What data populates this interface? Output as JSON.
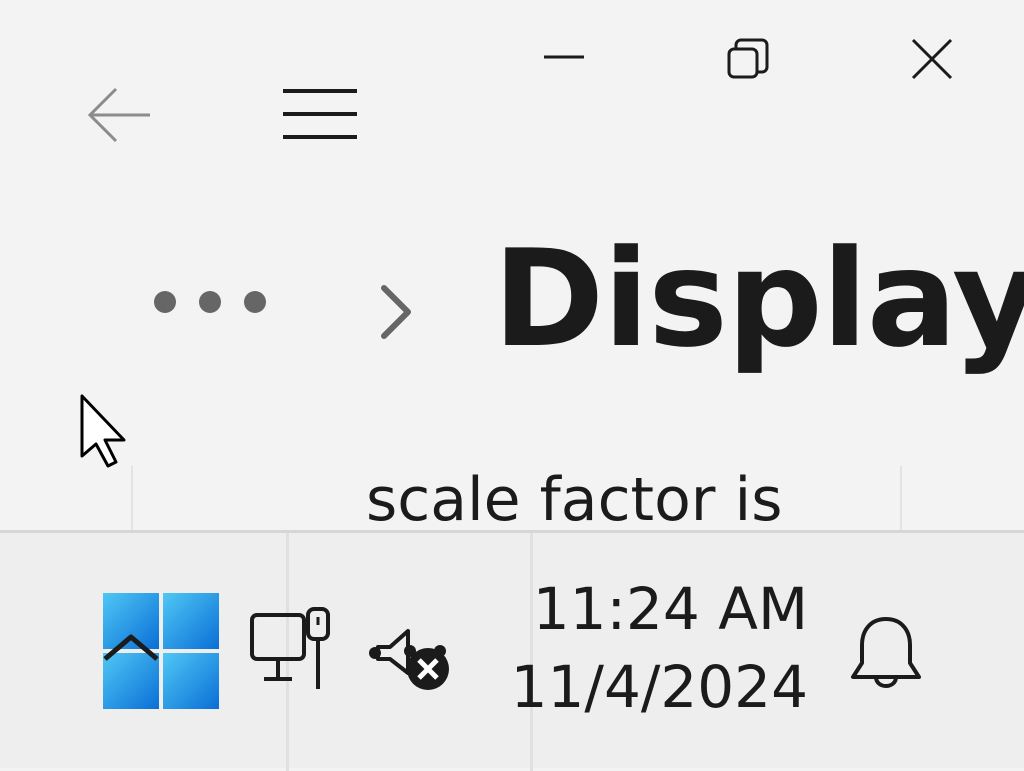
{
  "window": {
    "title": "Display",
    "breadcrumb_more": "more",
    "content_text": "scale factor is",
    "caption_buttons": {
      "minimize_icon": "minimize-icon",
      "restore_icon": "restore-icon",
      "close_icon": "close-icon"
    },
    "nav": {
      "back_icon": "back-arrow-icon",
      "menu_icon": "hamburger-menu-icon"
    }
  },
  "taskbar": {
    "start_icon": "windows-start-icon",
    "overflow_icon": "chevron-up-icon",
    "network_icon": "ethernet-network-icon",
    "volume_icon": "volume-muted-icon",
    "clock": {
      "time": "11:24 AM",
      "date": "11/4/2024"
    },
    "notification_icon": "bell-icon"
  },
  "colors": {
    "background": "#f3f3f3",
    "taskbar": "#eeeeee",
    "start_blue": "#0a74d8",
    "text": "#1b1b1b"
  }
}
